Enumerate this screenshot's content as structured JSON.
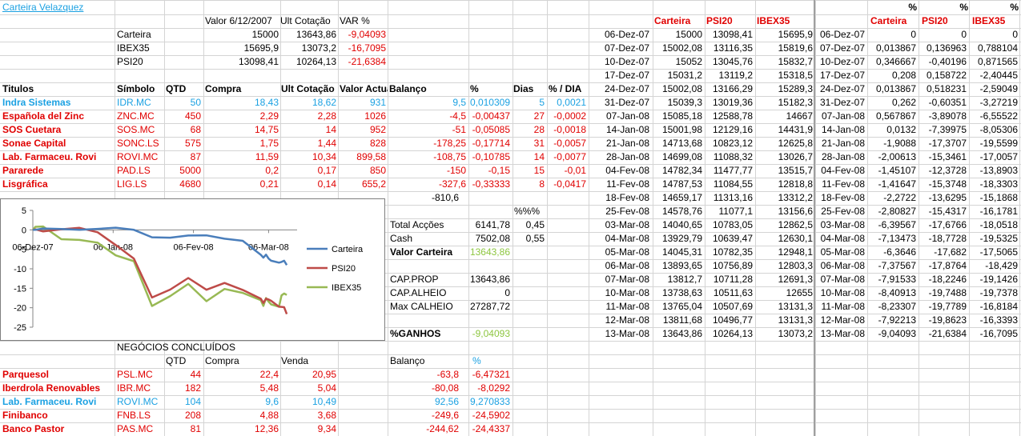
{
  "title": "Carteira Velazquez",
  "colors": {
    "red": "#e00000",
    "blue": "#1ba1e2",
    "green": "#8dc63f",
    "chart_blue": "#4a7ebb",
    "chart_red": "#be4b48",
    "chart_green": "#98b954"
  },
  "summary": {
    "headers": [
      "Valor 6/12/2007",
      "Ult Cotação",
      "VAR %"
    ],
    "rows": [
      {
        "name": "Carteira",
        "valor": "15000",
        "ult": "13643,86",
        "var": "-9,04093"
      },
      {
        "name": "IBEX35",
        "valor": "15695,9",
        "ult": "13073,2",
        "var": "-16,7095"
      },
      {
        "name": "PSI20",
        "valor": "13098,41",
        "ult": "10264,13",
        "var": "-21,6384"
      }
    ]
  },
  "positions": {
    "headers": [
      "Titulos",
      "Símbolo",
      "QTD",
      "Compra",
      "Ult Cotação",
      "Valor Actual",
      "Balanço",
      "%",
      "Dias",
      "% / DIA"
    ],
    "rows": [
      {
        "titulo": "Indra Sistemas",
        "simbolo": "IDR.MC",
        "qtd": "50",
        "compra": "18,43",
        "ult": "18,62",
        "valor": "931",
        "balanco": "9,5",
        "pct": "0,010309",
        "dias": "5",
        "pdia": "0,0021",
        "color": "blue"
      },
      {
        "titulo": "Española del Zinc",
        "simbolo": "ZNC.MC",
        "qtd": "450",
        "compra": "2,29",
        "ult": "2,28",
        "valor": "1026",
        "balanco": "-4,5",
        "pct": "-0,00437",
        "dias": "27",
        "pdia": "-0,0002",
        "color": "red"
      },
      {
        "titulo": "SOS Cuetara",
        "simbolo": "SOS.MC",
        "qtd": "68",
        "compra": "14,75",
        "ult": "14",
        "valor": "952",
        "balanco": "-51",
        "pct": "-0,05085",
        "dias": "28",
        "pdia": "-0,0018",
        "color": "red"
      },
      {
        "titulo": "Sonae Capital",
        "simbolo": "SONC.LS",
        "qtd": "575",
        "compra": "1,75",
        "ult": "1,44",
        "valor": "828",
        "balanco": "-178,25",
        "pct": "-0,17714",
        "dias": "31",
        "pdia": "-0,0057",
        "color": "red"
      },
      {
        "titulo": "Lab. Farmaceu. Rovi",
        "simbolo": "ROVI.MC",
        "qtd": "87",
        "compra": "11,59",
        "ult": "10,34",
        "valor": "899,58",
        "balanco": "-108,75",
        "pct": "-0,10785",
        "dias": "14",
        "pdia": "-0,0077",
        "color": "red"
      },
      {
        "titulo": "Pararede",
        "simbolo": "PAD.LS",
        "qtd": "5000",
        "compra": "0,2",
        "ult": "0,17",
        "valor": "850",
        "balanco": "-150",
        "pct": "-0,15",
        "dias": "15",
        "pdia": "-0,01",
        "color": "red"
      },
      {
        "titulo": "Lisgráfica",
        "simbolo": "LIG.LS",
        "qtd": "4680",
        "compra": "0,21",
        "ult": "0,14",
        "valor": "655,2",
        "balanco": "-327,6",
        "pct": "-0,33333",
        "dias": "8",
        "pdia": "-0,0417",
        "color": "red"
      }
    ],
    "total_balanco": "-810,6"
  },
  "totals": {
    "pct_header": "%%%",
    "total_accoes_label": "Total Acções",
    "total_accoes": "6141,78",
    "total_accoes_pct": "0,45",
    "cash_label": "Cash",
    "cash": "7502,08",
    "cash_pct": "0,55",
    "valor_carteira_label": "Valor Carteira",
    "valor_carteira": "13643,86",
    "cap_prop_label": "CAP.PROP",
    "cap_prop": "13643,86",
    "cap_alheio_label": "CAP.ALHEIO",
    "cap_alheio": "0",
    "max_calheio_label": "Max CALHEIO",
    "max_calheio": "27287,72",
    "ganhos_label": "%GANHOS",
    "ganhos": "-9,04093"
  },
  "closed": {
    "title": "NEGÓCIOS CONCLUÍDOS",
    "headers": [
      "QTD",
      "Compra",
      "Venda",
      "Balanço",
      "%"
    ],
    "rows": [
      {
        "name": "Parquesol",
        "symbol": "PSL.MC",
        "qtd": "44",
        "compra": "22,4",
        "venda": "20,95",
        "balanco": "-63,8",
        "pct": "-6,47321",
        "color": "red"
      },
      {
        "name": "Iberdrola Renovables",
        "symbol": "IBR.MC",
        "qtd": "182",
        "compra": "5,48",
        "venda": "5,04",
        "balanco": "-80,08",
        "pct": "-8,0292",
        "color": "red"
      },
      {
        "name": "Lab. Farmaceu. Rovi",
        "symbol": "ROVI.MC",
        "qtd": "104",
        "compra": "9,6",
        "venda": "10,49",
        "balanco": "92,56",
        "pct": "9,270833",
        "color": "blue"
      },
      {
        "name": "Finibanco",
        "symbol": "FNB.LS",
        "qtd": "208",
        "compra": "4,88",
        "venda": "3,68",
        "balanco": "-249,6",
        "pct": "-24,5902",
        "color": "red"
      },
      {
        "name": "Banco Pastor",
        "symbol": "PAS.MC",
        "qtd": "81",
        "compra": "12,36",
        "venda": "9,34",
        "balanco": "-244,62",
        "pct": "-24,4337",
        "color": "red"
      }
    ]
  },
  "history": {
    "headers": [
      "Carteira",
      "PSI20",
      "IBEX35"
    ],
    "rows": [
      [
        "06-Dez-07",
        "15000",
        "13098,41",
        "15695,9"
      ],
      [
        "07-Dez-07",
        "15002,08",
        "13116,35",
        "15819,6"
      ],
      [
        "10-Dez-07",
        "15052",
        "13045,76",
        "15832,7"
      ],
      [
        "17-Dez-07",
        "15031,2",
        "13119,2",
        "15318,5"
      ],
      [
        "24-Dez-07",
        "15002,08",
        "13166,29",
        "15289,3"
      ],
      [
        "31-Dez-07",
        "15039,3",
        "13019,36",
        "15182,3"
      ],
      [
        "07-Jan-08",
        "15085,18",
        "12588,78",
        "14667"
      ],
      [
        "14-Jan-08",
        "15001,98",
        "12129,16",
        "14431,9"
      ],
      [
        "21-Jan-08",
        "14713,68",
        "10823,12",
        "12625,8"
      ],
      [
        "28-Jan-08",
        "14699,08",
        "11088,32",
        "13026,7"
      ],
      [
        "04-Fev-08",
        "14782,34",
        "11477,77",
        "13515,7"
      ],
      [
        "11-Fev-08",
        "14787,53",
        "11084,55",
        "12818,8"
      ],
      [
        "18-Fev-08",
        "14659,17",
        "11313,16",
        "13312,2"
      ],
      [
        "25-Fev-08",
        "14578,76",
        "11077,1",
        "13156,6"
      ],
      [
        "03-Mar-08",
        "14040,65",
        "10783,05",
        "12862,5"
      ],
      [
        "04-Mar-08",
        "13929,79",
        "10639,47",
        "12630,1"
      ],
      [
        "05-Mar-08",
        "14045,31",
        "10782,35",
        "12948,1"
      ],
      [
        "06-Mar-08",
        "13893,65",
        "10756,89",
        "12803,3"
      ],
      [
        "07-Mar-08",
        "13812,7",
        "10711,28",
        "12691,3"
      ],
      [
        "10-Mar-08",
        "13738,63",
        "10511,63",
        "12655"
      ],
      [
        "11-Mar-08",
        "13765,04",
        "10507,69",
        "13131,3"
      ],
      [
        "12-Mar-08",
        "13811,68",
        "10496,77",
        "13131,3"
      ],
      [
        "13-Mar-08",
        "13643,86",
        "10264,13",
        "13073,2"
      ]
    ]
  },
  "pct_table": {
    "top": [
      "%",
      "%",
      "%"
    ],
    "headers": [
      "Carteira",
      "PSI20",
      "IBEX35"
    ],
    "rows": [
      [
        "06-Dez-07",
        "0",
        "0",
        "0"
      ],
      [
        "07-Dez-07",
        "0,013867",
        "0,136963",
        "0,788104"
      ],
      [
        "10-Dez-07",
        "0,346667",
        "-0,40196",
        "0,871565"
      ],
      [
        "17-Dez-07",
        "0,208",
        "0,158722",
        "-2,40445"
      ],
      [
        "24-Dez-07",
        "0,013867",
        "0,518231",
        "-2,59049"
      ],
      [
        "31-Dez-07",
        "0,262",
        "-0,60351",
        "-3,27219"
      ],
      [
        "07-Jan-08",
        "0,567867",
        "-3,89078",
        "-6,55522"
      ],
      [
        "14-Jan-08",
        "0,0132",
        "-7,39975",
        "-8,05306"
      ],
      [
        "21-Jan-08",
        "-1,9088",
        "-17,3707",
        "-19,5599"
      ],
      [
        "28-Jan-08",
        "-2,00613",
        "-15,3461",
        "-17,0057"
      ],
      [
        "04-Fev-08",
        "-1,45107",
        "-12,3728",
        "-13,8903"
      ],
      [
        "11-Fev-08",
        "-1,41647",
        "-15,3748",
        "-18,3303"
      ],
      [
        "18-Fev-08",
        "-2,2722",
        "-13,6295",
        "-15,1868"
      ],
      [
        "25-Fev-08",
        "-2,80827",
        "-15,4317",
        "-16,1781"
      ],
      [
        "03-Mar-08",
        "-6,39567",
        "-17,6766",
        "-18,0518"
      ],
      [
        "04-Mar-08",
        "-7,13473",
        "-18,7728",
        "-19,5325"
      ],
      [
        "05-Mar-08",
        "-6,3646",
        "-17,682",
        "-17,5065"
      ],
      [
        "06-Mar-08",
        "-7,37567",
        "-17,8764",
        "-18,429"
      ],
      [
        "07-Mar-08",
        "-7,91533",
        "-18,2246",
        "-19,1426"
      ],
      [
        "10-Mar-08",
        "-8,40913",
        "-19,7488",
        "-19,7378"
      ],
      [
        "11-Mar-08",
        "-8,23307",
        "-19,7789",
        "-16,8184"
      ],
      [
        "12-Mar-08",
        "-7,92213",
        "-19,8623",
        "-16,3393"
      ],
      [
        "13-Mar-08",
        "-9,04093",
        "-21,6384",
        "-16,7095"
      ]
    ]
  },
  "chart_data": {
    "type": "line",
    "x_tick_labels": [
      "06-Dez-07",
      "06-Jan-08",
      "06-Fev-08",
      "06-Mar-08"
    ],
    "yticks": [
      "5",
      "0",
      "-5",
      "-10",
      "-15",
      "-20",
      "-25"
    ],
    "ylim": [
      -25,
      5
    ],
    "legend": [
      "Carteira",
      "PSI20",
      "IBEX35"
    ],
    "legend_placement": "right",
    "grid": false,
    "x": [
      "06-Dez-07",
      "07-Dez-07",
      "10-Dez-07",
      "17-Dez-07",
      "24-Dez-07",
      "31-Dez-07",
      "07-Jan-08",
      "14-Jan-08",
      "21-Jan-08",
      "28-Jan-08",
      "04-Fev-08",
      "11-Fev-08",
      "18-Fev-08",
      "25-Fev-08",
      "03-Mar-08",
      "04-Mar-08",
      "05-Mar-08",
      "06-Mar-08",
      "07-Mar-08",
      "10-Mar-08",
      "11-Mar-08",
      "12-Mar-08",
      "13-Mar-08"
    ],
    "series": [
      {
        "name": "Carteira",
        "color": "#4a7ebb",
        "values": [
          0,
          0.013867,
          0.346667,
          0.208,
          0.013867,
          0.262,
          0.567867,
          0.0132,
          -1.9088,
          -2.00613,
          -1.45107,
          -1.41647,
          -2.2722,
          -2.80827,
          -6.39567,
          -7.13473,
          -6.3646,
          -7.37567,
          -7.91533,
          -8.40913,
          -8.23307,
          -7.92213,
          -9.04093
        ]
      },
      {
        "name": "PSI20",
        "color": "#be4b48",
        "values": [
          0,
          0.136963,
          -0.40196,
          0.158722,
          0.518231,
          -0.60351,
          -3.89078,
          -7.39975,
          -17.3707,
          -15.3461,
          -12.3728,
          -15.3748,
          -13.6295,
          -15.4317,
          -17.6766,
          -18.7728,
          -17.682,
          -17.8764,
          -18.2246,
          -19.7488,
          -19.7789,
          -19.8623,
          -21.6384
        ]
      },
      {
        "name": "IBEX35",
        "color": "#98b954",
        "values": [
          0,
          0.788104,
          0.871565,
          -2.40445,
          -2.59049,
          -3.27219,
          -6.55522,
          -8.05306,
          -19.5599,
          -17.0057,
          -13.8903,
          -18.3303,
          -15.1868,
          -16.1781,
          -18.0518,
          -19.5325,
          -17.5065,
          -18.429,
          -19.1426,
          -19.7378,
          -16.8184,
          -16.3393,
          -16.7095
        ]
      }
    ]
  }
}
